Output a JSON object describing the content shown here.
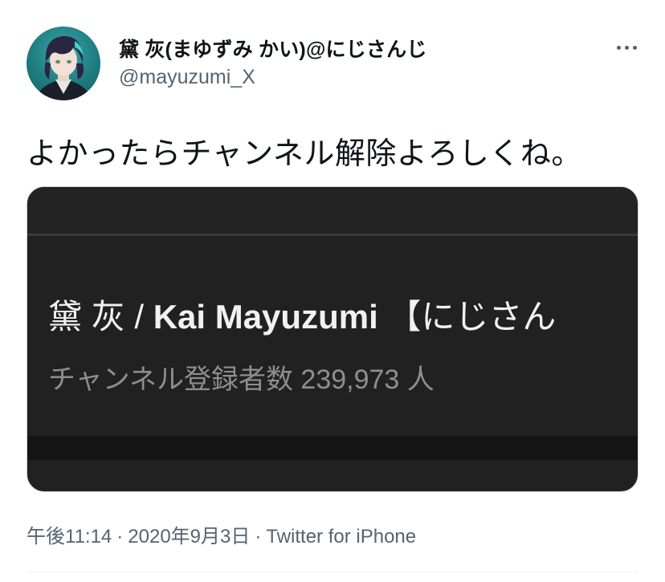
{
  "tweet": {
    "author": {
      "display_name": "黛 灰(まゆずみ かい)@にじさんじ",
      "handle": "@mayuzumi_X"
    },
    "text": "よかったらチャンネル解除よろしくね。",
    "media": {
      "channel_name_jp": "黛 灰 / ",
      "channel_name_en": "Kai Mayuzumi",
      "channel_name_suffix": " 【にじさん",
      "subscriber_text": "チャンネル登録者数 239,973 人"
    },
    "meta": {
      "time": "午後11:14",
      "separator_1": "·",
      "date": "2020年9月3日",
      "separator_2": "·",
      "source": "Twitter for iPhone"
    }
  },
  "icons": {
    "more": "more-horizontal-icon",
    "avatar": "avatar-image"
  },
  "colors": {
    "text_primary": "#0f1419",
    "text_secondary": "#536471",
    "media_bg": "#212121",
    "avatar_bg": "#1f7c80"
  }
}
